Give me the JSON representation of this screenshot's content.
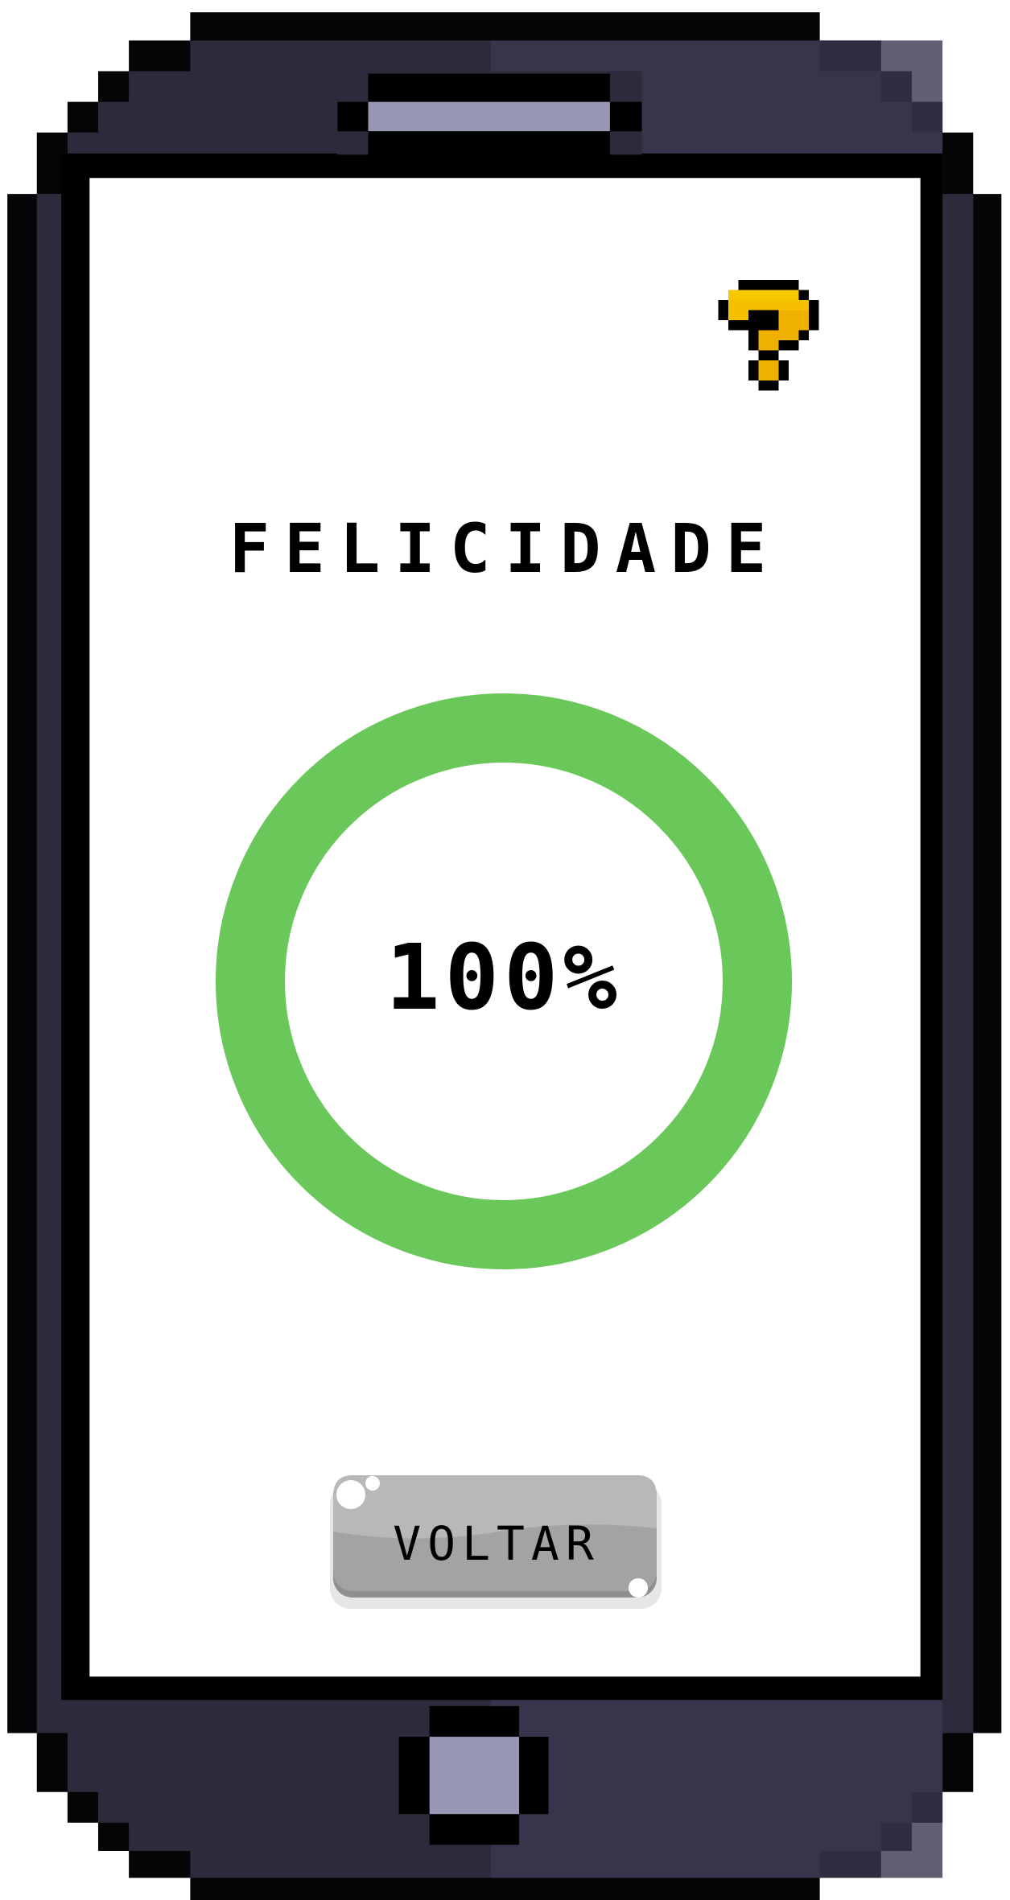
{
  "screen": {
    "title": "FELICIDADE",
    "happiness_percent": 100,
    "percent_label": "100%",
    "back_button_label": "VOLTAR",
    "help_icon": "question-mark-icon"
  },
  "colors": {
    "ring": "#6ac759",
    "body_dark": "#2b2b3b",
    "body_light": "#3a3850",
    "screen": "#ffffff",
    "speaker": "#9597b5",
    "help": "#f5b800"
  }
}
